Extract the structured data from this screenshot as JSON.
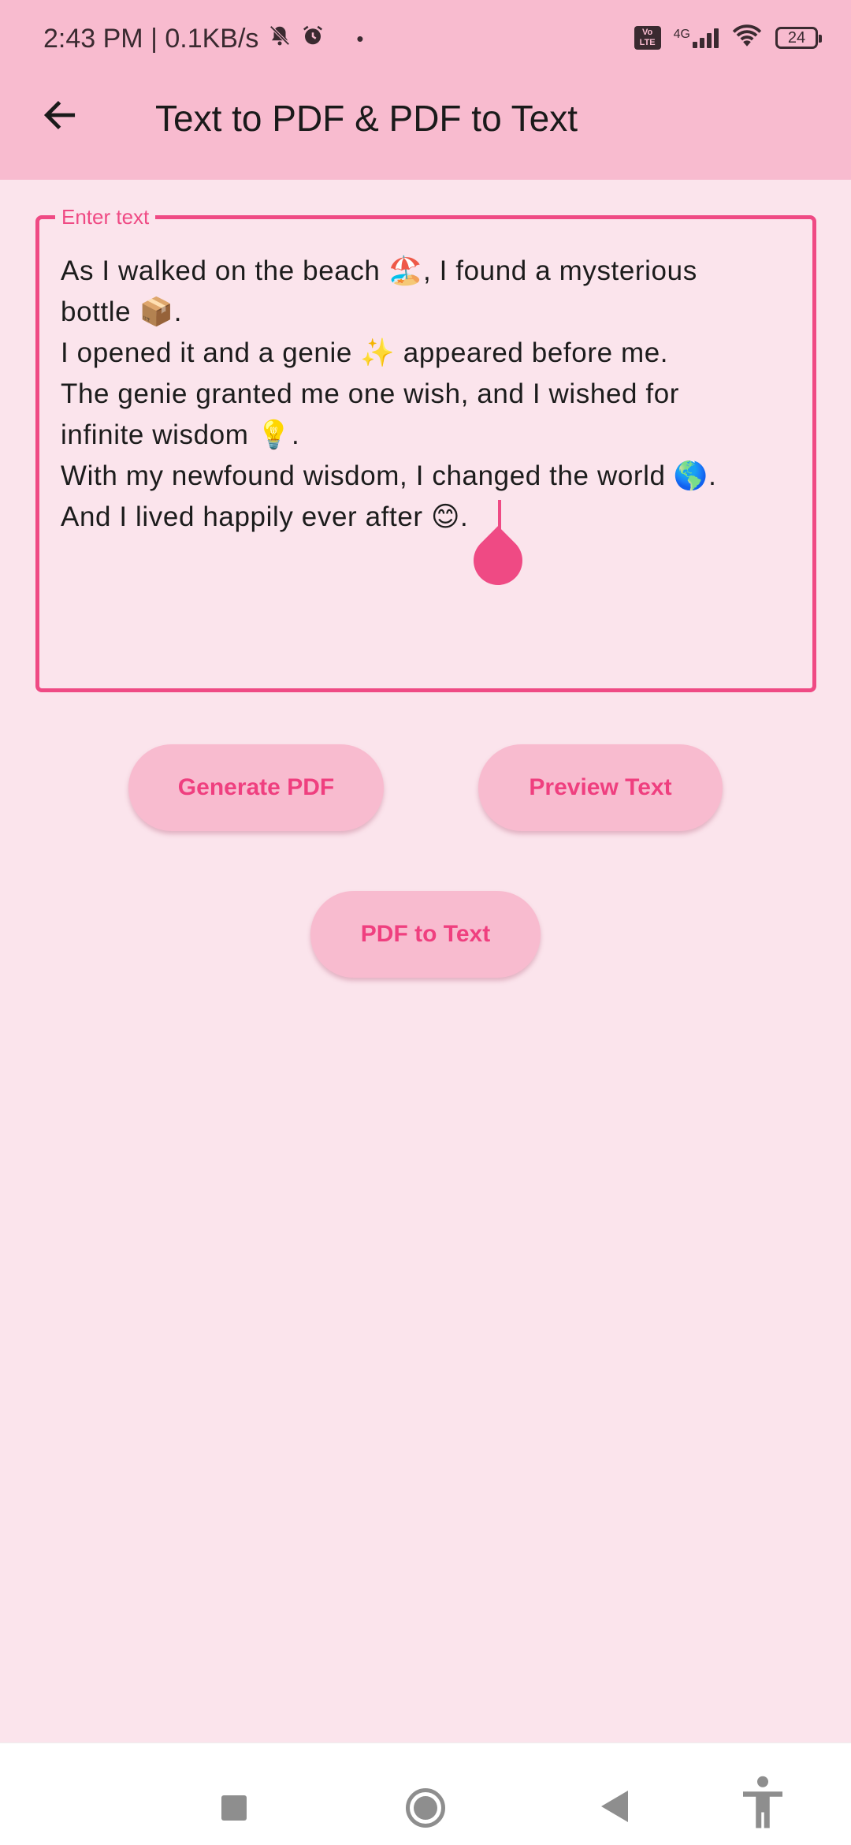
{
  "status_bar": {
    "time_and_speed": "2:43 PM | 0.1KB/s",
    "dot": "•",
    "volte_label": "Vo LTE",
    "network_type": "4G",
    "battery_level": "24",
    "icons": [
      "mute-icon",
      "alarm-icon",
      "volte-icon",
      "signal-icon",
      "wifi-icon",
      "battery-icon"
    ]
  },
  "app_bar": {
    "title": "Text to PDF & PDF to Text",
    "back_icon": "arrow-left-icon"
  },
  "text_field": {
    "label": "Enter text",
    "value": "As I walked on the beach 🏖️, I found a mysterious\nbottle 📦.\nI opened it and a genie ✨ appeared before me.\nThe genie granted me one wish, and I wished for\ninfinite wisdom 💡.\nWith my newfound wisdom, I changed the world 🌎.\nAnd I lived happily ever after 😊.",
    "accent_color": "#ef4a84"
  },
  "buttons": {
    "generate_pdf": "Generate PDF",
    "preview_text": "Preview Text",
    "pdf_to_text": "PDF to Text"
  },
  "nav_bar": {
    "icons": [
      "recents-square-icon",
      "home-circle-icon",
      "back-triangle-icon",
      "accessibility-icon"
    ]
  },
  "colors": {
    "app_bar_bg": "#f8bbcf",
    "page_bg": "#fbe4ec",
    "accent": "#ef4a84"
  }
}
